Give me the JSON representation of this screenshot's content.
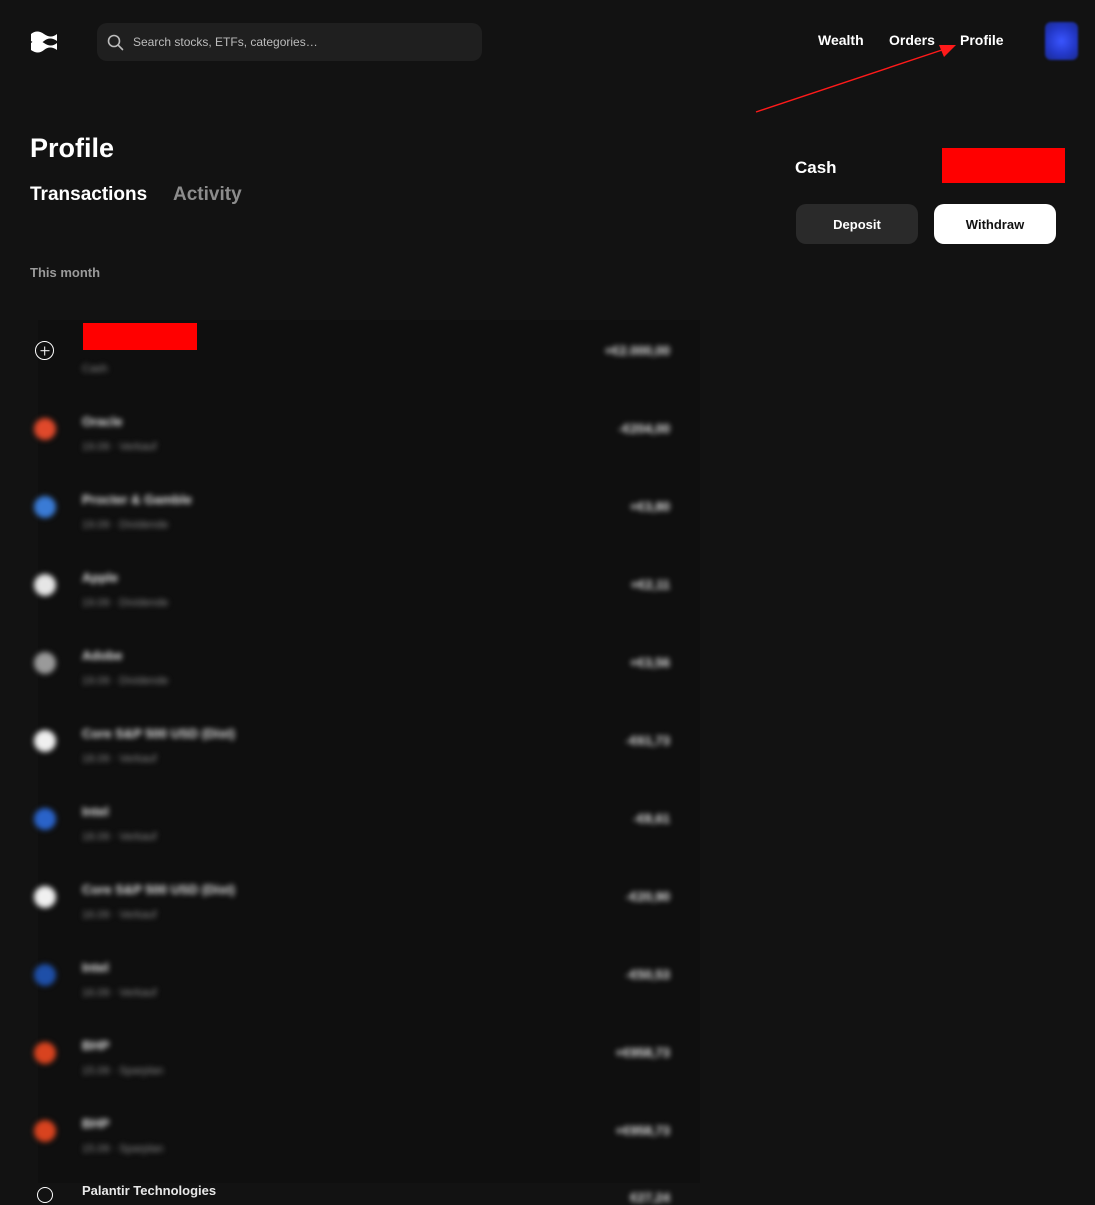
{
  "header": {
    "search_placeholder": "Search stocks, ETFs, categories…",
    "nav": [
      "Wealth",
      "Orders",
      "Profile"
    ]
  },
  "page": {
    "title": "Profile",
    "tabs": [
      {
        "label": "Transactions",
        "active": true
      },
      {
        "label": "Activity",
        "active": false
      }
    ],
    "section_label": "This month"
  },
  "cash": {
    "label": "Cash",
    "deposit_label": "Deposit",
    "withdraw_label": "Withdraw"
  },
  "transactions": [
    {
      "icon": "plus-circle-icon",
      "name": "",
      "sub": "Cash",
      "amount": "+€2.000,00",
      "color": "#ffffff"
    },
    {
      "icon": "oracle-logo-icon",
      "name": "Oracle",
      "sub": "19.09 · Verkauf",
      "amount": "-€204,00",
      "color": "#e0492b"
    },
    {
      "icon": "procter-gamble-logo-icon",
      "name": "Procter & Gamble",
      "sub": "19.09 · Dividende",
      "amount": "+€3,80",
      "color": "#3a7bd5"
    },
    {
      "icon": "apple-logo-icon",
      "name": "Apple",
      "sub": "19.09 · Dividende",
      "amount": "+€2,11",
      "color": "#e6e6e6"
    },
    {
      "icon": "adobe-logo-icon",
      "name": "Adobe",
      "sub": "19.09 · Dividende",
      "amount": "+€3,56",
      "color": "#9a9a9a"
    },
    {
      "icon": "etf-logo-icon",
      "name": "Core S&P 500 USD (Dist)",
      "sub": "18.09 · Verkauf",
      "amount": "-€61,73",
      "color": "#f0f0f0"
    },
    {
      "icon": "intel-logo-icon",
      "name": "Intel",
      "sub": "18.09 · Verkauf",
      "amount": "-€8,61",
      "color": "#2a63c9"
    },
    {
      "icon": "etf-logo-icon",
      "name": "Core S&P 500 USD (Dist)",
      "sub": "16.09 · Verkauf",
      "amount": "-€20,90",
      "color": "#f0f0f0"
    },
    {
      "icon": "intel-logo-icon",
      "name": "Intel",
      "sub": "16.09 · Verkauf",
      "amount": "-€50,53",
      "color": "#1e4fa8"
    },
    {
      "icon": "bhp-logo-icon",
      "name": "BHP",
      "sub": "15.09 · Sparplan",
      "amount": "+€958,73",
      "color": "#d8431f"
    },
    {
      "icon": "bhp-logo-icon",
      "name": "BHP",
      "sub": "15.09 · Sparplan",
      "amount": "+€958,73",
      "color": "#d8431f"
    }
  ],
  "last_partial": {
    "name": "Palantir Technologies",
    "amount": "€27,24"
  }
}
